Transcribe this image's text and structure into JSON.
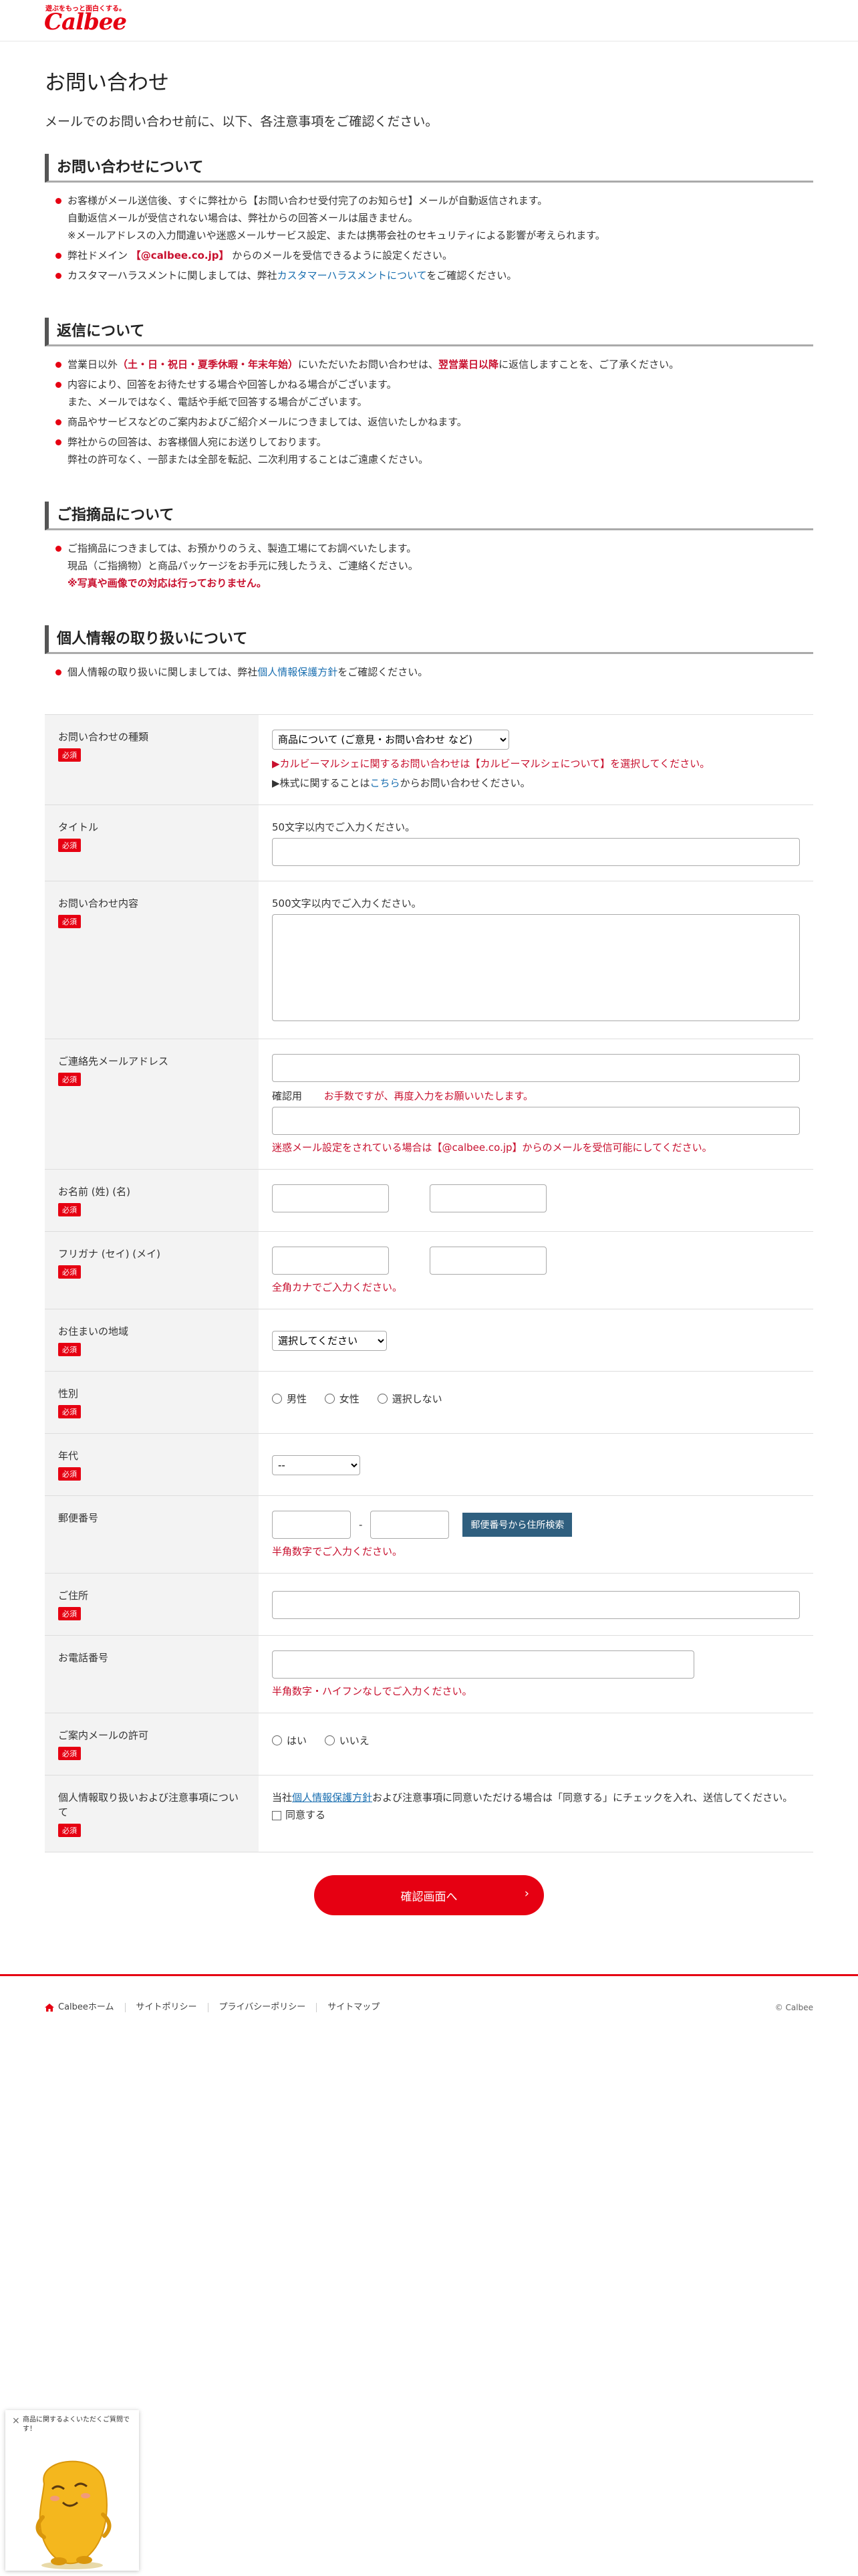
{
  "header": {
    "tagline": "遊ぶをもっと面白くする。",
    "logo": "Calbee"
  },
  "page": {
    "title": "お問い合わせ",
    "lead": "メールでのお問い合わせ前に、以下、各注意事項をご確認ください。"
  },
  "sections": {
    "inquiry": {
      "heading": "お問い合わせについて",
      "i1a": "お客様がメール送信後、すぐに弊社から【お問い合わせ受付完了のお知らせ】メールが自動返信されます。",
      "i1b": "自動返信メールが受信されない場合は、弊社からの回答メールは届きません。",
      "i1c": "※メールアドレスの入力間違いや迷惑メールサービス設定、または携帯会社のセキュリティによる影響が考えられます。",
      "i2a": "弊社ドメイン",
      "i2b": "【@calbee.co.jp】",
      "i2c": "からのメールを受信できるように設定ください。",
      "i3a": "カスタマーハラスメントに関しましては、弊社",
      "i3link": "カスタマーハラスメントについて",
      "i3c": "をご確認ください。"
    },
    "reply": {
      "heading": "返信について",
      "i1a": "営業日以外",
      "i1b": "（土・日・祝日・夏季休暇・年末年始）",
      "i1c": "にいただいたお問い合わせは、",
      "i1d": "翌営業日以降",
      "i1e": "に返信しますことを、ご了承ください。",
      "i2a": "内容により、回答をお待たせする場合や回答しかねる場合がございます。",
      "i2b": "また、メールではなく、電話や手紙で回答する場合がございます。",
      "i3": "商品やサービスなどのご案内およびご紹介メールにつきましては、返信いたしかねます。",
      "i4a": "弊社からの回答は、お客様個人宛にお送りしております。",
      "i4b": "弊社の許可なく、一部または全部を転記、二次利用することはご遠慮ください。"
    },
    "product": {
      "heading": "ご指摘品について",
      "i1a": "ご指摘品につきましては、お預かりのうえ、製造工場にてお調べいたします。",
      "i1b": "現品（ご指摘物）と商品パッケージをお手元に残したうえ、ご連絡ください。",
      "i1c": "※写真や画像での対応は行っておりません。"
    },
    "privacy": {
      "heading": "個人情報の取り扱いについて",
      "i1a": "個人情報の取り扱いに関しましては、弊社",
      "i1link": "個人情報保護方針",
      "i1c": "をご確認ください。"
    }
  },
  "form": {
    "required": "必須",
    "type": {
      "label": "お問い合わせの種類",
      "selected": "商品について (ご意見・お問い合わせ など)",
      "note1": "▶カルビーマルシェに関するお問い合わせは【カルビーマルシェについて】を選択してください。",
      "note2a": "▶株式に関することは",
      "note2link": "こちら",
      "note2c": "からお問い合わせください。"
    },
    "title": {
      "label": "タイトル",
      "hint": "50文字以内でご入力ください。"
    },
    "content": {
      "label": "お問い合わせ内容",
      "hint": "500文字以内でご入力ください。"
    },
    "email": {
      "label": "ご連絡先メールアドレス",
      "confirm": "確認用",
      "confirm_note": "お手数ですが、再度入力をお願いいたします。",
      "note": "迷惑メール設定をされている場合は【@calbee.co.jp】からのメールを受信可能にしてください。"
    },
    "name": {
      "label": "お名前 (姓) (名)"
    },
    "kana": {
      "label": "フリガナ (セイ) (メイ)",
      "note": "全角カナでご入力ください。"
    },
    "region": {
      "label": "お住まいの地域",
      "selected": "選択してください"
    },
    "gender": {
      "label": "性別",
      "options": [
        "男性",
        "女性",
        "選択しない"
      ]
    },
    "age": {
      "label": "年代",
      "selected": "--"
    },
    "zip": {
      "label": "郵便番号",
      "sep": "-",
      "button": "郵便番号から住所検索",
      "note": "半角数字でご入力ください。"
    },
    "address": {
      "label": "ご住所"
    },
    "phone": {
      "label": "お電話番号",
      "note": "半角数字・ハイフンなしでご入力ください。"
    },
    "mail_permission": {
      "label": "ご案内メールの許可",
      "options": [
        "はい",
        "いいえ"
      ]
    },
    "agree": {
      "label": "個人情報取り扱いおよび注意事項について",
      "text_a": "当社",
      "link": "個人情報保護方針",
      "text_c": "および注意事項に同意いただける場合は「同意する」にチェックを入れ、送信してください。",
      "checkbox": "同意する"
    },
    "submit": "確認画面へ",
    "submit_chevron": "›"
  },
  "footer": {
    "links": [
      "Calbeeホーム",
      "サイトポリシー",
      "プライバシーポリシー",
      "サイトマップ"
    ],
    "copyright": "© Calbee"
  },
  "widget": {
    "close": "×",
    "message": "商品に関するよくいただくご質問です！"
  },
  "colors": {
    "brand": "#e60012",
    "link": "#1a6fb0",
    "button_dark": "#2f5f7f"
  }
}
